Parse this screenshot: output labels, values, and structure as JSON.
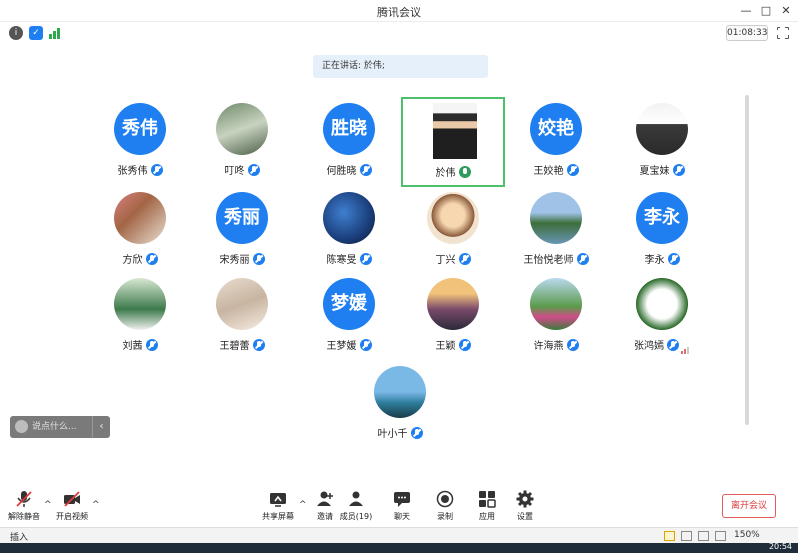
{
  "window": {
    "title": "腾讯会议"
  },
  "infobar": {
    "timer": "01:08:33"
  },
  "speaking": {
    "label": "正在讲话: 於伟;"
  },
  "participants": [
    {
      "name": "张秀伟",
      "avatar_text": "秀伟",
      "mic": "off"
    },
    {
      "name": "叮咚",
      "avatar_text": "",
      "mic": "off"
    },
    {
      "name": "何胜晓",
      "avatar_text": "胜晓",
      "mic": "off"
    },
    {
      "name": "於伟",
      "avatar_text": "",
      "mic": "on"
    },
    {
      "name": "王姣艳",
      "avatar_text": "姣艳",
      "mic": "off"
    },
    {
      "name": "夏宝妹",
      "avatar_text": "",
      "mic": "off"
    },
    {
      "name": "方欣",
      "avatar_text": "",
      "mic": "off"
    },
    {
      "name": "宋秀丽",
      "avatar_text": "秀丽",
      "mic": "off"
    },
    {
      "name": "陈寒旻",
      "avatar_text": "",
      "mic": "off"
    },
    {
      "name": "丁兴",
      "avatar_text": "",
      "mic": "off"
    },
    {
      "name": "王怡悦老师",
      "avatar_text": "",
      "mic": "off"
    },
    {
      "name": "李永",
      "avatar_text": "李永",
      "mic": "off"
    },
    {
      "name": "刘茜",
      "avatar_text": "",
      "mic": "off"
    },
    {
      "name": "王碧蕾",
      "avatar_text": "",
      "mic": "off"
    },
    {
      "name": "王梦媛",
      "avatar_text": "梦媛",
      "mic": "off"
    },
    {
      "name": "王颖",
      "avatar_text": "",
      "mic": "off"
    },
    {
      "name": "许海燕",
      "avatar_text": "",
      "mic": "off"
    },
    {
      "name": "张鸿嫣",
      "avatar_text": "",
      "mic": "off"
    },
    {
      "name": "叶小千",
      "avatar_text": "",
      "mic": "off"
    }
  ],
  "chat": {
    "placeholder": "说点什么..."
  },
  "toolbar": {
    "unmute": "解除静音",
    "start_video": "开启视频",
    "share_screen": "共享屏幕",
    "invite": "邀请",
    "members": "成员(19)",
    "chat": "聊天",
    "record": "录制",
    "apps": "应用",
    "settings": "设置",
    "leave": "离开会议"
  },
  "statusbar": {
    "insert": "插入",
    "zoom": "150%"
  },
  "taskbar": {
    "clock": "20:54"
  },
  "colors": {
    "accent": "#1f7ff0",
    "active_border": "#4cc06a",
    "leave": "#e03a3a"
  }
}
